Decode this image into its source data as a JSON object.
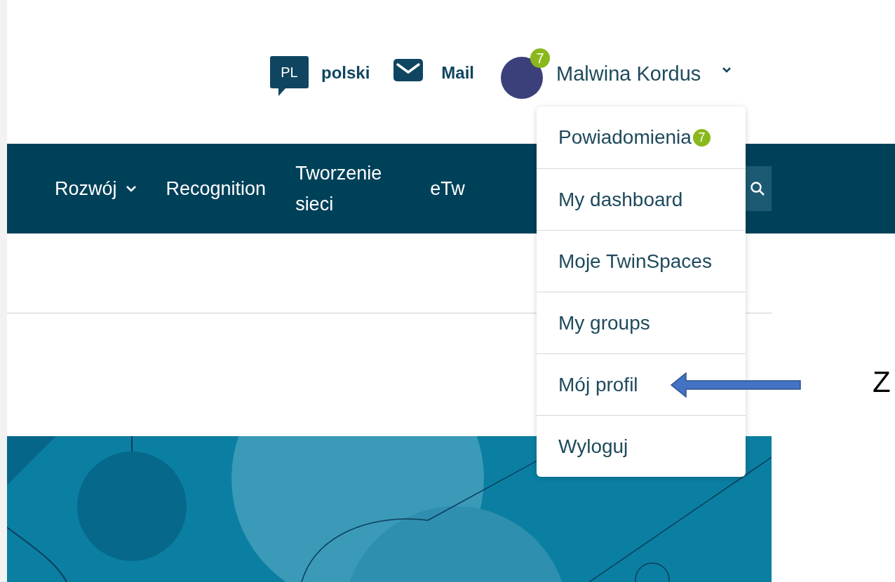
{
  "header": {
    "language": {
      "code": "PL",
      "label": "polski"
    },
    "mail": {
      "label": "Mail"
    },
    "user": {
      "name": "Malwina Kordus",
      "badge": "7"
    }
  },
  "nav": {
    "items": [
      {
        "label": "Rozwój",
        "kind": "dropdown"
      },
      {
        "label": "Recognition",
        "kind": "link"
      },
      {
        "label": "Tworzenie sieci",
        "kind": "link"
      },
      {
        "label": "eTw",
        "kind": "link"
      }
    ]
  },
  "user_menu": {
    "items": [
      {
        "label": "Powiadomienia",
        "badge": "7"
      },
      {
        "label": "My dashboard"
      },
      {
        "label": "Moje TwinSpaces"
      },
      {
        "label": "My groups"
      },
      {
        "label": "Mój profil"
      },
      {
        "label": "Wyloguj"
      }
    ]
  },
  "annotation": {
    "text": "Z"
  }
}
